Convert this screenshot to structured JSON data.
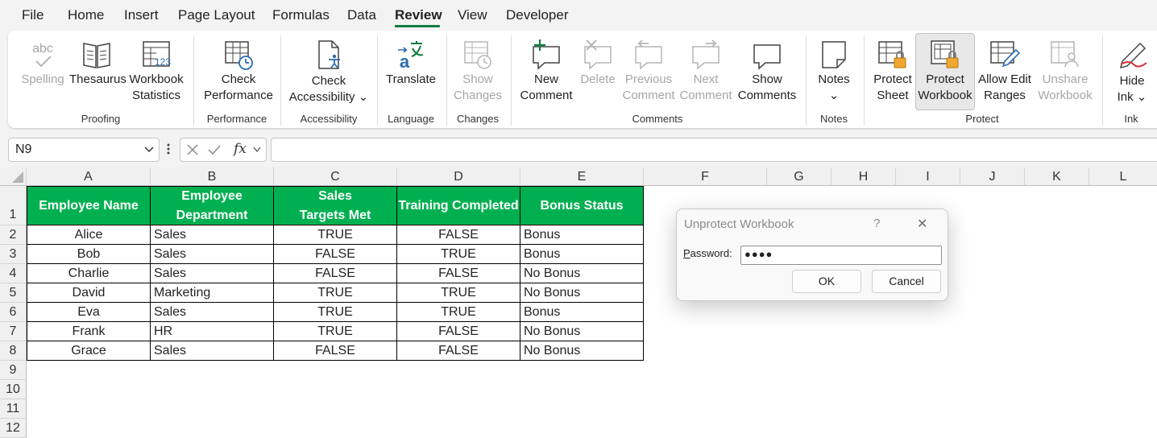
{
  "menu": {
    "items": [
      "File",
      "Home",
      "Insert",
      "Page Layout",
      "Formulas",
      "Data",
      "Review",
      "View",
      "Developer"
    ],
    "active": "Review",
    "accent_color": "#107c41"
  },
  "ribbon": {
    "buttons": {
      "spelling": {
        "line1": "Spelling",
        "line2": "",
        "disabled": true
      },
      "thesaurus": {
        "line1": "Thesaurus",
        "line2": ""
      },
      "workbook_statistics": {
        "line1": "Workbook",
        "line2": "Statistics"
      },
      "check_performance": {
        "line1": "Check",
        "line2": "Performance"
      },
      "check_accessibility": {
        "line1": "Check",
        "line2": "Accessibility ⌄"
      },
      "translate": {
        "line1": "Translate",
        "line2": ""
      },
      "show_changes": {
        "line1": "Show",
        "line2": "Changes",
        "disabled": true
      },
      "new_comment": {
        "line1": "New",
        "line2": "Comment"
      },
      "delete": {
        "line1": "Delete",
        "line2": "",
        "disabled": true
      },
      "previous_comment": {
        "line1": "Previous",
        "line2": "Comment",
        "disabled": true
      },
      "next_comment": {
        "line1": "Next",
        "line2": "Comment",
        "disabled": true
      },
      "show_comments": {
        "line1": "Show",
        "line2": "Comments"
      },
      "notes": {
        "line1": "Notes",
        "line2": "⌄"
      },
      "protect_sheet": {
        "line1": "Protect",
        "line2": "Sheet"
      },
      "protect_workbook": {
        "line1": "Protect",
        "line2": "Workbook",
        "selected": true
      },
      "allow_edit_ranges": {
        "line1": "Allow Edit",
        "line2": "Ranges"
      },
      "unshare_workbook": {
        "line1": "Unshare",
        "line2": "Workbook",
        "disabled": true
      },
      "hide_ink": {
        "line1": "Hide",
        "line2": "Ink ⌄"
      }
    },
    "groups": {
      "proofing": "Proofing",
      "performance": "Performance",
      "accessibility": "Accessibility",
      "language": "Language",
      "changes": "Changes",
      "comments": "Comments",
      "notes": "Notes",
      "protect": "Protect",
      "ink": "Ink"
    },
    "spelling_icon_text": "abc",
    "stats_icon_text": "123"
  },
  "formula_bar": {
    "name_box": "N9",
    "fx": "fx",
    "formula": ""
  },
  "grid": {
    "columns": [
      "A",
      "B",
      "C",
      "D",
      "E",
      "F",
      "G",
      "H",
      "I",
      "J",
      "K",
      "L"
    ],
    "rows": [
      "1",
      "2",
      "3",
      "4",
      "5",
      "6",
      "7",
      "8",
      "9",
      "10",
      "11",
      "12"
    ],
    "header_color": "#00b050",
    "headers": [
      {
        "l1": "Employee Name",
        "l2": ""
      },
      {
        "l1": "Employee",
        "l2": "Department"
      },
      {
        "l1": "Sales",
        "l2": "Targets Met"
      },
      {
        "l1": "Training Completed",
        "l2": ""
      },
      {
        "l1": "Bonus Status",
        "l2": ""
      }
    ],
    "data": [
      [
        "Alice",
        "Sales",
        "TRUE",
        "FALSE",
        "Bonus"
      ],
      [
        "Bob",
        "Sales",
        "FALSE",
        "TRUE",
        "Bonus"
      ],
      [
        "Charlie",
        "Sales",
        "FALSE",
        "FALSE",
        "No Bonus"
      ],
      [
        "David",
        "Marketing",
        "TRUE",
        "TRUE",
        "No Bonus"
      ],
      [
        "Eva",
        "Sales",
        "TRUE",
        "TRUE",
        "Bonus"
      ],
      [
        "Frank",
        "HR",
        "TRUE",
        "FALSE",
        "No Bonus"
      ],
      [
        "Grace",
        "Sales",
        "FALSE",
        "FALSE",
        "No Bonus"
      ]
    ]
  },
  "dialog": {
    "title": "Unprotect Workbook",
    "help": "?",
    "close": "✕",
    "password_label_first": "P",
    "password_label_rest": "assword:",
    "password_value": "●●●●",
    "ok": "OK",
    "cancel": "Cancel"
  }
}
